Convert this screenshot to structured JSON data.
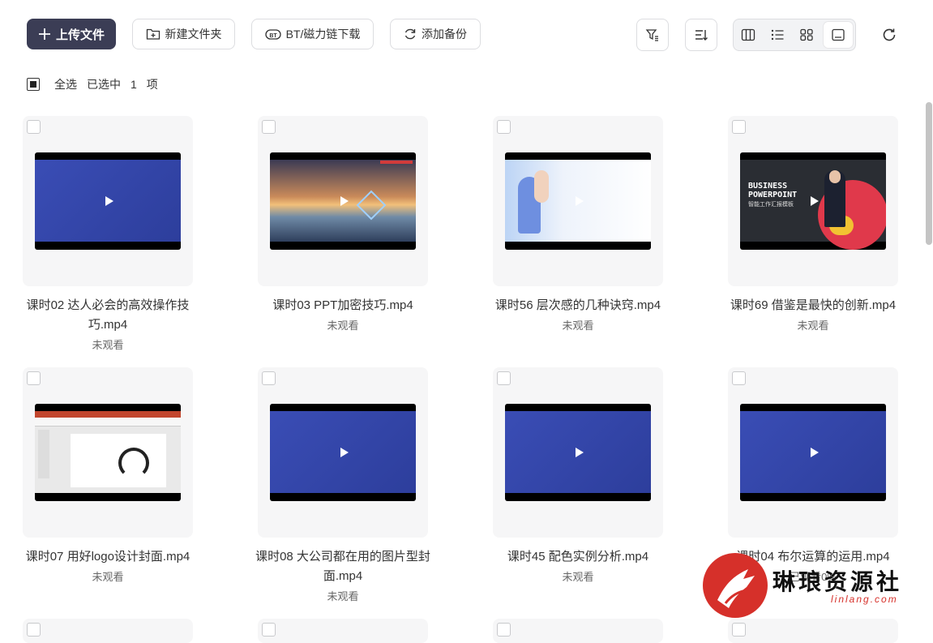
{
  "toolbar": {
    "upload_label": "上传文件",
    "new_folder_label": "新建文件夹",
    "bt_label": "BT/磁力链下载",
    "backup_label": "添加备份"
  },
  "select": {
    "all_label": "全选",
    "selected_prefix": "已选中",
    "count": "1",
    "unit": "项"
  },
  "files": [
    {
      "name": "课时02 达人必会的高效操作技巧.mp4",
      "status": "未观看",
      "thumb": "blue"
    },
    {
      "name": "课时03 PPT加密技巧.mp4",
      "status": "未观看",
      "thumb": "sunset"
    },
    {
      "name": "课时56 层次感的几种诀窍.mp4",
      "status": "未观看",
      "thumb": "hand"
    },
    {
      "name": "课时69 借鉴是最快的创新.mp4",
      "status": "未观看",
      "thumb": "business"
    },
    {
      "name": "课时07 用好logo设计封面.mp4",
      "status": "未观看",
      "thumb": "ppt"
    },
    {
      "name": "课时08 大公司都在用的图片型封面.mp4",
      "status": "未观看",
      "thumb": "blue"
    },
    {
      "name": "课时45 配色实例分析.mp4",
      "status": "未观看",
      "thumb": "blue"
    },
    {
      "name": "课时04 布尔运算的运用.mp4",
      "status": "已观看0%",
      "thumb": "blue"
    }
  ],
  "thumb_text": {
    "business_line1": "BUSINESS",
    "business_line2": "POWERPOINT",
    "business_sub": "智能工作汇报模板"
  },
  "watermark": {
    "title": "琳琅资源社",
    "url": "linlang.com"
  },
  "colors": {
    "primary": "#3b3d55",
    "thumb_blue": "#3446a8",
    "watermark_red": "#d6302a"
  }
}
